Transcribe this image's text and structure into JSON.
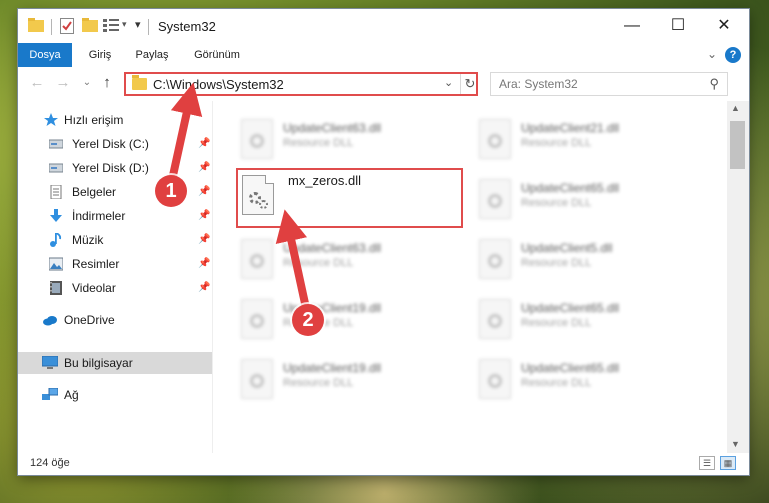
{
  "window": {
    "title": "System32",
    "controls": {
      "minimize": "—",
      "maximize": "☐",
      "close": "✕"
    }
  },
  "ribbon": {
    "tabs": [
      {
        "label": "Dosya",
        "active": true
      },
      {
        "label": "Giriş"
      },
      {
        "label": "Paylaş"
      },
      {
        "label": "Görünüm"
      }
    ],
    "help": "?"
  },
  "nav": {
    "address": "C:\\Windows\\System32",
    "search_placeholder": "Ara: System32"
  },
  "sidebar": {
    "items": [
      {
        "label": "Hızlı erişim",
        "icon": "star-icon",
        "pinned": false
      },
      {
        "label": "Yerel Disk (C:)",
        "icon": "drive-icon",
        "pinned": true
      },
      {
        "label": "Yerel Disk (D:)",
        "icon": "drive-icon",
        "pinned": true
      },
      {
        "label": "Belgeler",
        "icon": "documents-icon",
        "pinned": true
      },
      {
        "label": "İndirmeler",
        "icon": "download-icon",
        "pinned": true
      },
      {
        "label": "Müzik",
        "icon": "music-icon",
        "pinned": true
      },
      {
        "label": "Resimler",
        "icon": "pictures-icon",
        "pinned": true
      },
      {
        "label": "Videolar",
        "icon": "video-icon",
        "pinned": true
      },
      {
        "label": "OneDrive",
        "icon": "cloud-icon",
        "pinned": false
      },
      {
        "label": "Bu bilgisayar",
        "icon": "computer-icon",
        "pinned": false,
        "selected": true
      },
      {
        "label": "Ağ",
        "icon": "network-icon",
        "pinned": false
      }
    ]
  },
  "files": {
    "highlighted": {
      "name": "mx_zeros.dll"
    },
    "left_column": [
      {
        "name": "UpdateClient63.dll",
        "type": "Resource DLL"
      },
      {
        "name": "UpdateClient63.dll",
        "type": "Resource DLL"
      },
      {
        "name": "UpdateClient19.dll",
        "type": "Resource DLL"
      },
      {
        "name": "UpdateClient19.dll",
        "type": "Resource DLL"
      }
    ],
    "right_column": [
      {
        "name": "UpdateClient21.dll",
        "type": "Resource DLL"
      },
      {
        "name": "UpdateClient65.dll",
        "type": "Resource DLL"
      },
      {
        "name": "UpdateClient5.dll",
        "type": "Resource DLL"
      },
      {
        "name": "UpdateClient65.dll",
        "type": "Resource DLL"
      },
      {
        "name": "UpdateClient65.dll",
        "type": "Resource DLL"
      }
    ]
  },
  "status": {
    "count": "124 öğe"
  },
  "annotations": {
    "step1": "1",
    "step2": "2"
  },
  "colors": {
    "accent": "#1979ca",
    "annotation": "#e04040",
    "folder": "#f2c94c"
  }
}
